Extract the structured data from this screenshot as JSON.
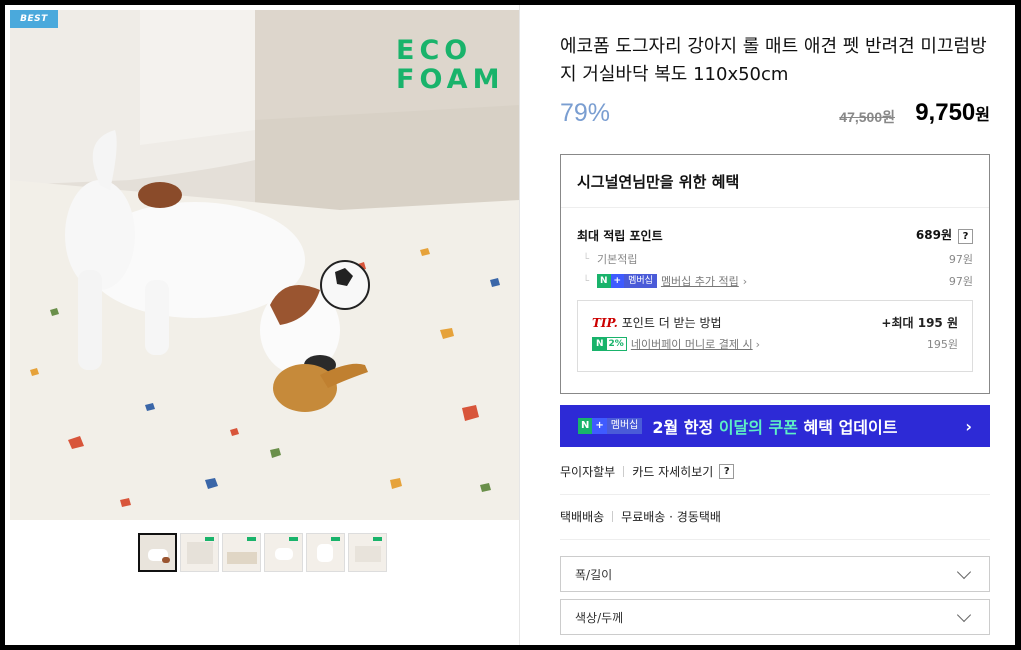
{
  "badge": "BEST",
  "logo": {
    "line1": "ECO",
    "line2": "FOAM"
  },
  "product": {
    "title": "에코폼 도그자리 강아지 롤 매트 애견 펫 반려견 미끄럼방지 거실바닥 복도 110x50cm",
    "discount": "79%",
    "original_price": "47,500원",
    "sale_price": "9,750",
    "sale_unit": "원"
  },
  "thumbnails_count": 6,
  "benefit": {
    "heading": "시그널연님만을 위한 혜택",
    "max_points_label": "최대 적립 포인트",
    "max_points_value": "689원",
    "help": "?",
    "basic_label": "기본적립",
    "basic_value": "97원",
    "membership_badge": {
      "n": "N",
      "plus": "+",
      "text": "멤버십"
    },
    "membership_label": "멤버십 추가 적립",
    "membership_value": "97원",
    "tip": {
      "label": "TIP.",
      "text": "포인트 더 받는 방법",
      "max_label": "+최대 195 원",
      "pay_badge_n": "N",
      "pay_badge_v": "2%",
      "pay_label": "네이버페이 머니로 결제 시",
      "pay_value": "195원"
    }
  },
  "banner": {
    "badge": {
      "n": "N",
      "plus": "+",
      "text": "멤버십"
    },
    "part1": "2월 한정 ",
    "highlight": "이달의 쿠폰",
    "part2": " 혜택 업데이트",
    "chevron": "›"
  },
  "payment": {
    "installment": "무이자할부",
    "card_detail": "카드 자세히보기",
    "help": "?"
  },
  "shipping": {
    "method": "택배배송",
    "detail": "무료배송 · 경동택배"
  },
  "options": [
    {
      "label": "폭/길이"
    },
    {
      "label": "색상/두께"
    }
  ],
  "colors": {
    "accent_green": "#19b36b",
    "banner_blue": "#2d2ad6",
    "discount_blue": "#7a9ed1"
  }
}
